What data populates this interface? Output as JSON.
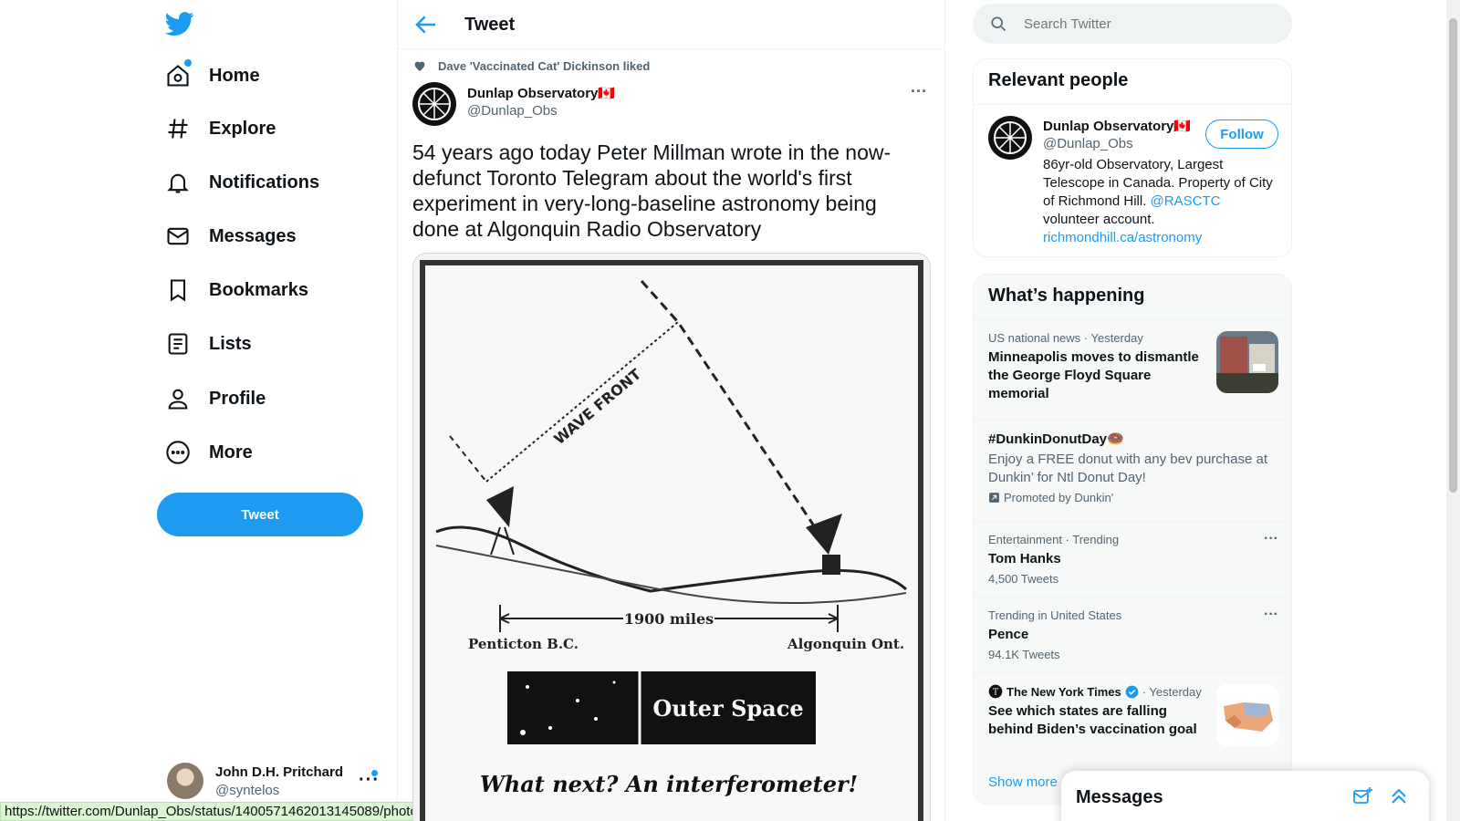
{
  "nav": {
    "items": [
      {
        "label": "Home",
        "icon": "home-icon"
      },
      {
        "label": "Explore",
        "icon": "hashtag-icon"
      },
      {
        "label": "Notifications",
        "icon": "bell-icon"
      },
      {
        "label": "Messages",
        "icon": "envelope-icon"
      },
      {
        "label": "Bookmarks",
        "icon": "bookmark-icon"
      },
      {
        "label": "Lists",
        "icon": "list-icon"
      },
      {
        "label": "Profile",
        "icon": "person-icon"
      },
      {
        "label": "More",
        "icon": "more-circle-icon"
      }
    ],
    "tweet_button": "Tweet"
  },
  "account": {
    "name": "John D.H. Pritchard",
    "handle": "@syntelos"
  },
  "status_url": "https://twitter.com/Dunlap_Obs/status/1400571462013145089/photo/1",
  "main": {
    "title": "Tweet",
    "social_context": "Dave 'Vaccinated Cat' Dickinson liked",
    "tweet": {
      "name": "Dunlap Observatory🇨🇦",
      "handle": "@Dunlap_Obs",
      "text": "54 years ago today Peter Millman wrote in the now-defunct Toronto Telegram about the world's first experiment in very-long-baseline astronomy being done at Algonquin Radio Observatory",
      "image_text": {
        "wave_front": "WAVE FRONT",
        "distance": "1900 miles",
        "left_site": "Penticton B.C.",
        "right_site": "Algonquin Ont.",
        "banner": "Outer Space",
        "caption": "What next? An interferometer!"
      }
    }
  },
  "search": {
    "placeholder": "Search Twitter"
  },
  "relevant_people": {
    "title": "Relevant people",
    "name": "Dunlap Observatory🇨🇦",
    "handle": "@Dunlap_Obs",
    "follow_label": "Follow",
    "bio_text": "86yr-old Observatory, Largest Telescope in Canada. Property of City of Richmond Hill.",
    "bio_mention": "@RASCTC",
    "bio_suffix": "volunteer account.",
    "bio_link": "richmondhill.ca/astronomy"
  },
  "happening": {
    "title": "What’s happening",
    "trends": [
      {
        "meta": "US national news · Yesterday",
        "title": "Minneapolis moves to dismantle the George Floyd Square memorial"
      },
      {
        "title": "#DunkinDonutDay🍩",
        "desc": "Enjoy a FREE donut with any bev purchase at Dunkin’ for Ntl Donut Day!",
        "promo": "Promoted by Dunkin'"
      },
      {
        "meta": "Entertainment · Trending",
        "title": "Tom Hanks",
        "sub": "4,500 Tweets"
      },
      {
        "meta": "Trending in United States",
        "title": "Pence",
        "sub": "94.1K Tweets"
      },
      {
        "source": "The New York Times",
        "time": "· Yesterday",
        "title": "See which states are falling behind Biden’s vaccination goal"
      }
    ],
    "show_more": "Show more"
  },
  "messages_drawer": {
    "title": "Messages"
  },
  "colors": {
    "accent": "#1d9bf0",
    "text": "#0f1419",
    "muted": "#536471"
  }
}
